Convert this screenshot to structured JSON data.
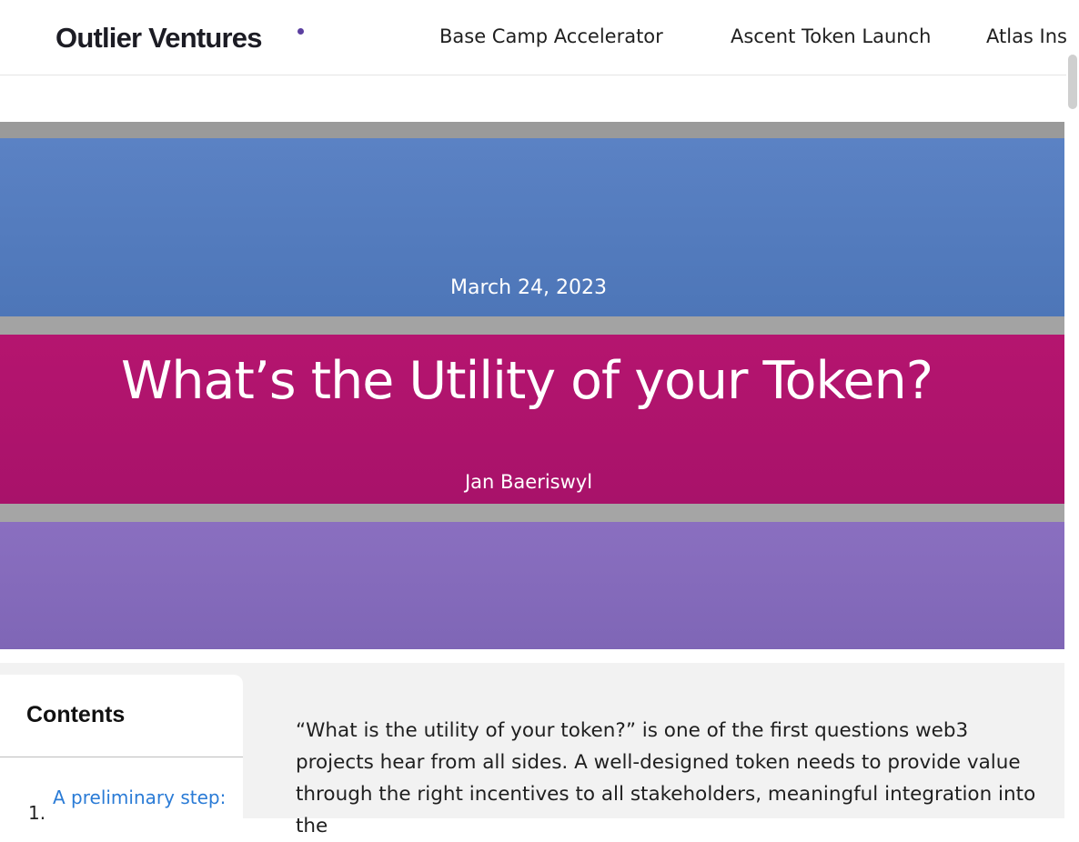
{
  "header": {
    "logo_text": "Outlier Ventures",
    "brand_dot_color": "#5b3fa0",
    "nav": [
      {
        "label": "Base Camp Accelerator"
      },
      {
        "label": "Ascent Token Launch"
      },
      {
        "label": "Atlas Insig"
      }
    ]
  },
  "hero": {
    "date": "March 24, 2023",
    "title": "What’s the Utility of your Token?",
    "author": "Jan Baeriswyl",
    "stripe_colors": [
      "#5b82c4",
      "#b5156f",
      "#8a6fc0"
    ]
  },
  "toc": {
    "heading": "Contents",
    "items": [
      {
        "number": "1.",
        "label": "A preliminary step:"
      }
    ]
  },
  "article": {
    "intro": "“What is the utility of your token?” is one of the first questions web3 projects hear from all sides. A well-designed token needs to provide value through the right incentives to all stakeholders, meaningful integration into the"
  }
}
